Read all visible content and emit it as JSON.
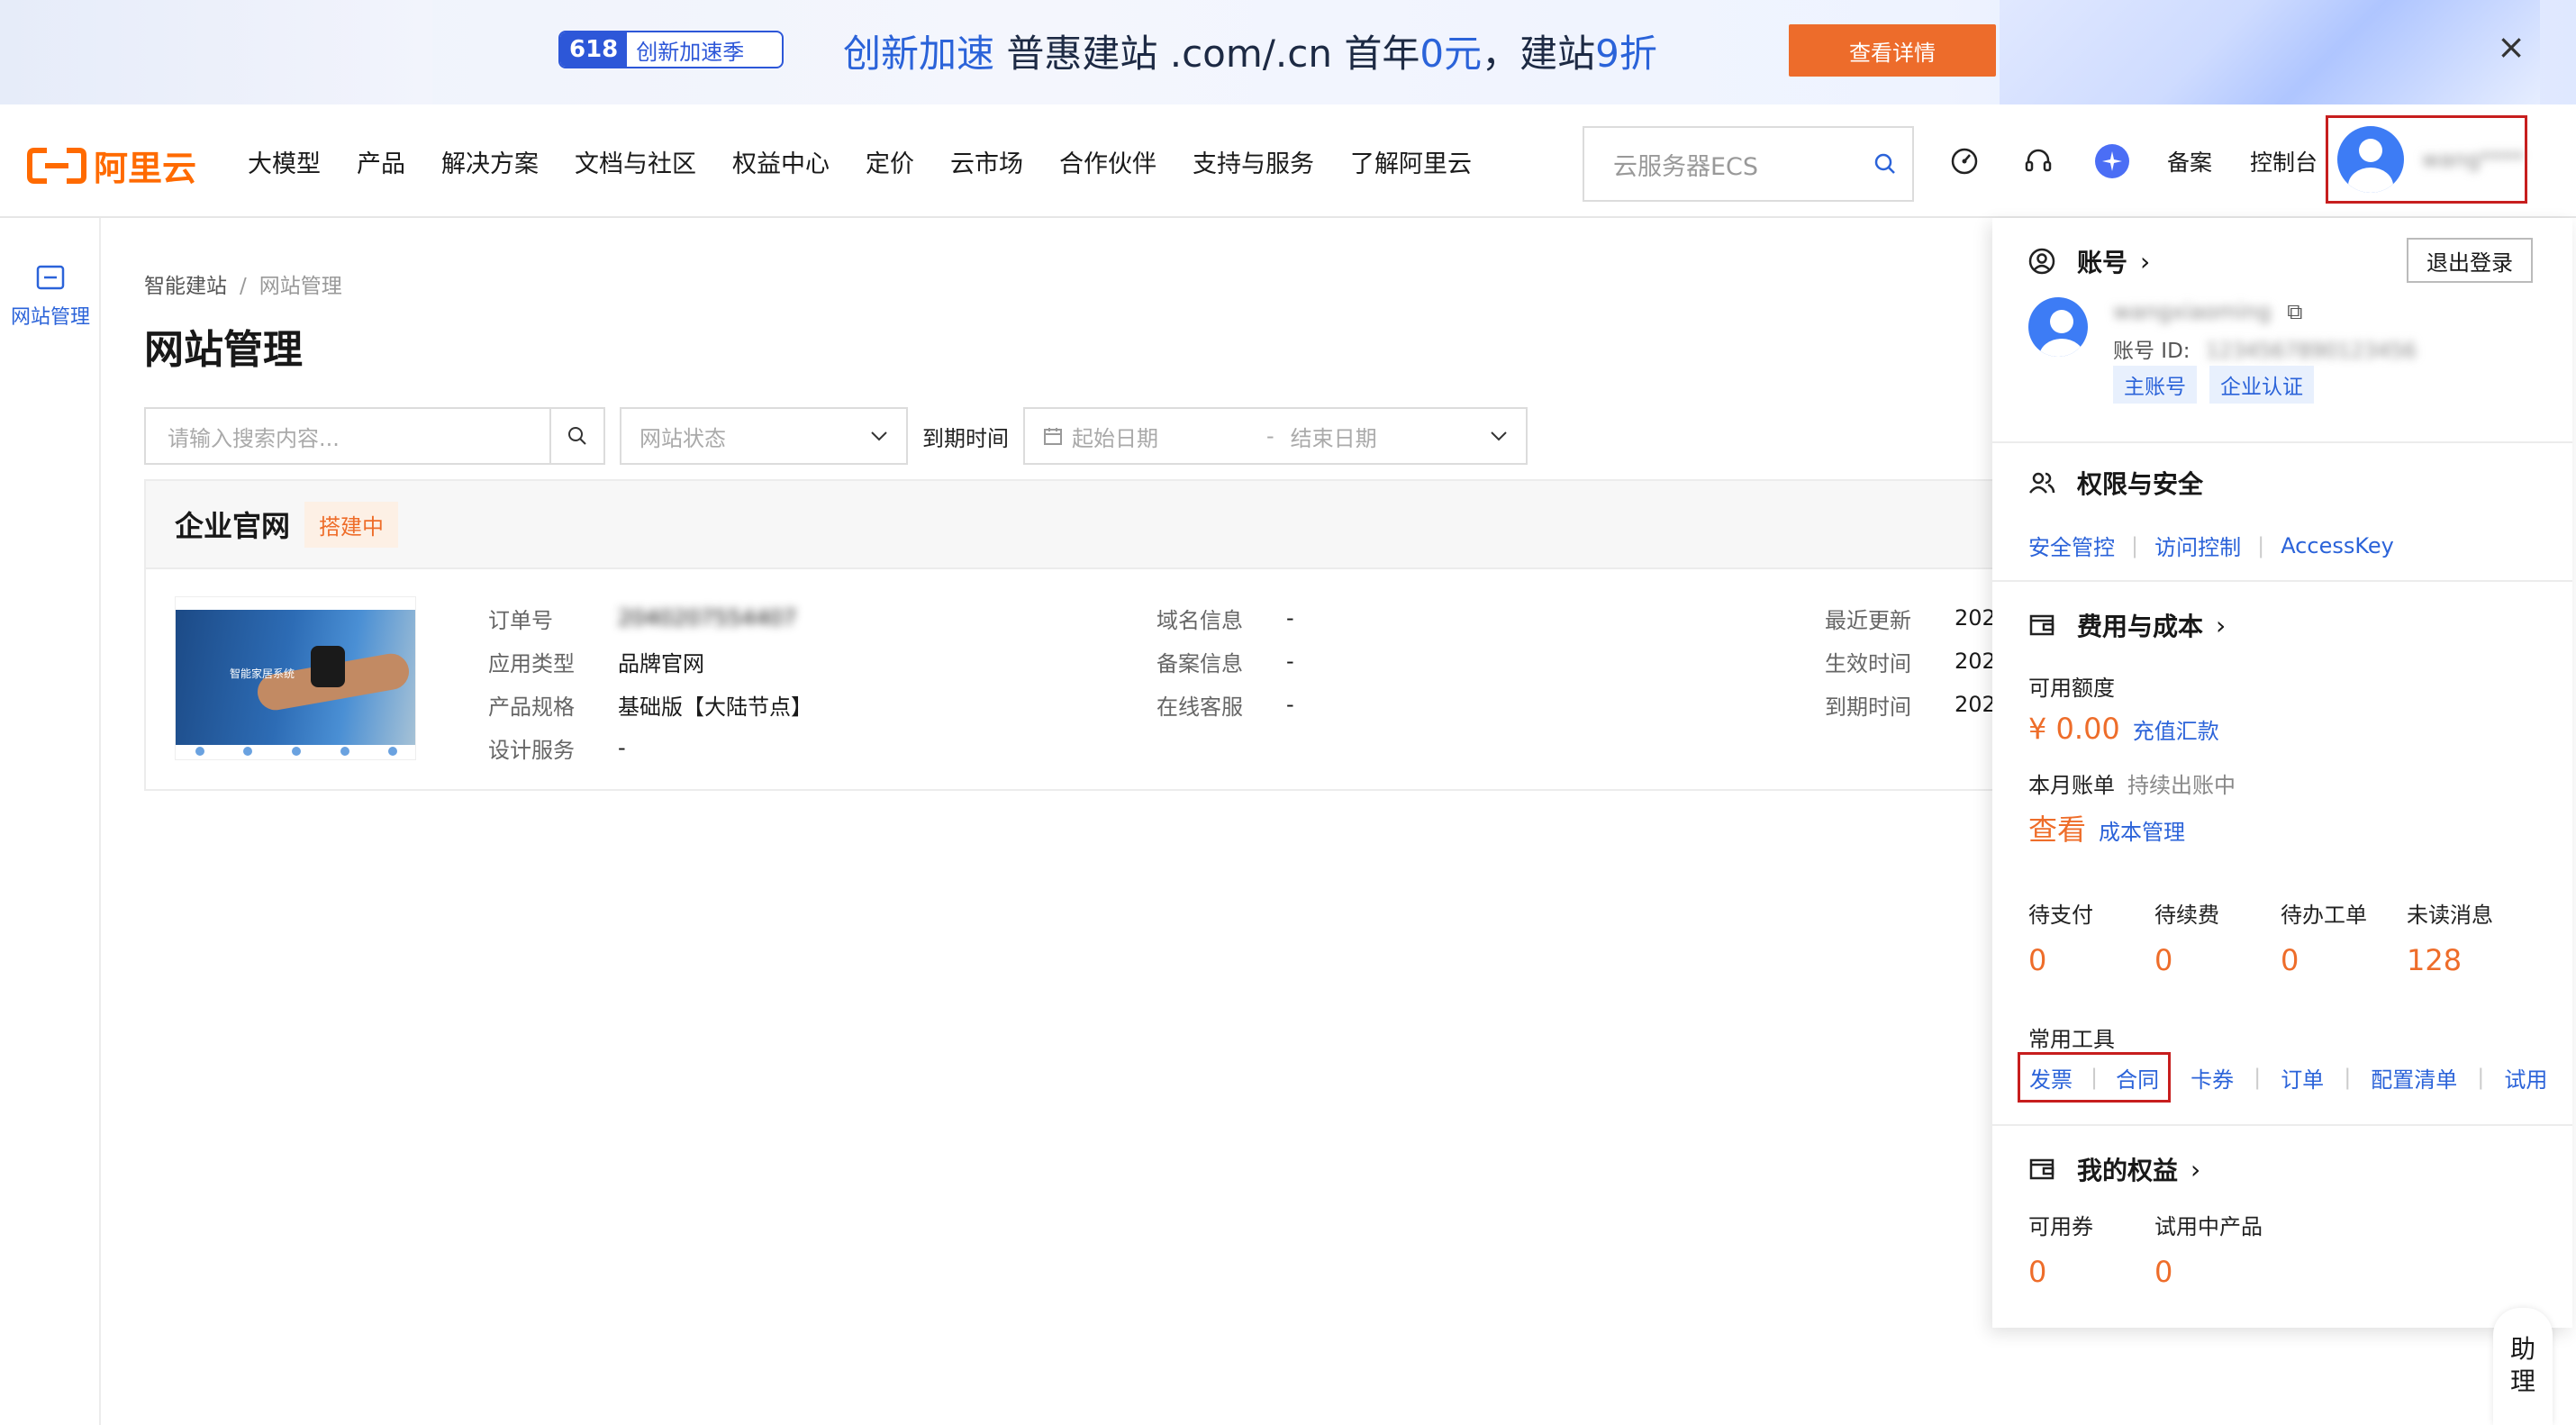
{
  "banner": {
    "badge_num": "618",
    "badge_text": "创新加速季",
    "headline_part1": "创新加速",
    "headline_part2": " 普惠建站  .com/.cn 首年",
    "headline_price": "0元",
    "headline_part3": "，建站",
    "headline_discount": "9折",
    "cta": "查看详情"
  },
  "nav": {
    "logo": "阿里云",
    "links": [
      "大模型",
      "产品",
      "解决方案",
      "文档与社区",
      "权益中心",
      "定价",
      "云市场",
      "合作伙伴",
      "支持与服务",
      "了解阿里云"
    ],
    "search_placeholder": "云服务器ECS",
    "filing": "备案",
    "console": "控制台",
    "username": "wang****"
  },
  "rail": {
    "label": "网站管理"
  },
  "breadcrumb": {
    "root": "智能建站",
    "sep": "/",
    "current": "网站管理"
  },
  "page_title": "网站管理",
  "filters": {
    "search_placeholder": "请输入搜索内容...",
    "status_placeholder": "网站状态",
    "expiry_label": "到期时间",
    "start_placeholder": "起始日期",
    "range_sep": "-",
    "end_placeholder": "结束日期"
  },
  "card": {
    "title": "企业官网",
    "status": "搭建中",
    "thumb_caption": "智能家居系统",
    "col1": [
      {
        "k": "订单号",
        "v": "2040207554407"
      },
      {
        "k": "应用类型",
        "v": "品牌官网"
      },
      {
        "k": "产品规格",
        "v": "基础版【大陆节点】"
      },
      {
        "k": "设计服务",
        "v": "-"
      }
    ],
    "col2": [
      {
        "k": "域名信息",
        "v": "-"
      },
      {
        "k": "备案信息",
        "v": "-"
      },
      {
        "k": "在线客服",
        "v": "-"
      }
    ],
    "col3": [
      {
        "k": "最近更新",
        "v": "202"
      },
      {
        "k": "生效时间",
        "v": "202"
      },
      {
        "k": "到期时间",
        "v": "202"
      }
    ]
  },
  "panel": {
    "account_title": "账号",
    "logout": "退出登录",
    "account_name": "wangxiaoming",
    "account_id_label": "账号 ID:",
    "account_id_value": "1234567890123456",
    "tags": [
      "主账号",
      "企业认证"
    ],
    "security_title": "权限与安全",
    "security_links": [
      "安全管控",
      "访问控制",
      "AccessKey"
    ],
    "cost_title": "费用与成本",
    "available_label": "可用额度",
    "available_amount": "¥ 0.00",
    "recharge": "充值汇款",
    "bill_label": "本月账单",
    "bill_status": "持续出账中",
    "bill_view": "查看",
    "cost_mgmt": "成本管理",
    "stats": [
      {
        "k": "待支付",
        "n": "0"
      },
      {
        "k": "待续费",
        "n": "0"
      },
      {
        "k": "待办工单",
        "n": "0"
      },
      {
        "k": "未读消息",
        "n": "128"
      }
    ],
    "tools_label": "常用工具",
    "tools_highlight": [
      "发票",
      "合同"
    ],
    "tools": [
      "卡券",
      "订单",
      "配置清单",
      "试用"
    ],
    "benefits_title": "我的权益",
    "benefits": [
      {
        "k": "可用券",
        "n": "0"
      },
      {
        "k": "试用中产品",
        "n": "0"
      }
    ]
  },
  "assistant": {
    "text1": "助",
    "text2": "理"
  },
  "colors": {
    "brand_orange": "#ff6a00",
    "link_blue": "#2b63d9",
    "accent_orange": "#ee6d2a",
    "highlight_red": "#c71e1e"
  }
}
